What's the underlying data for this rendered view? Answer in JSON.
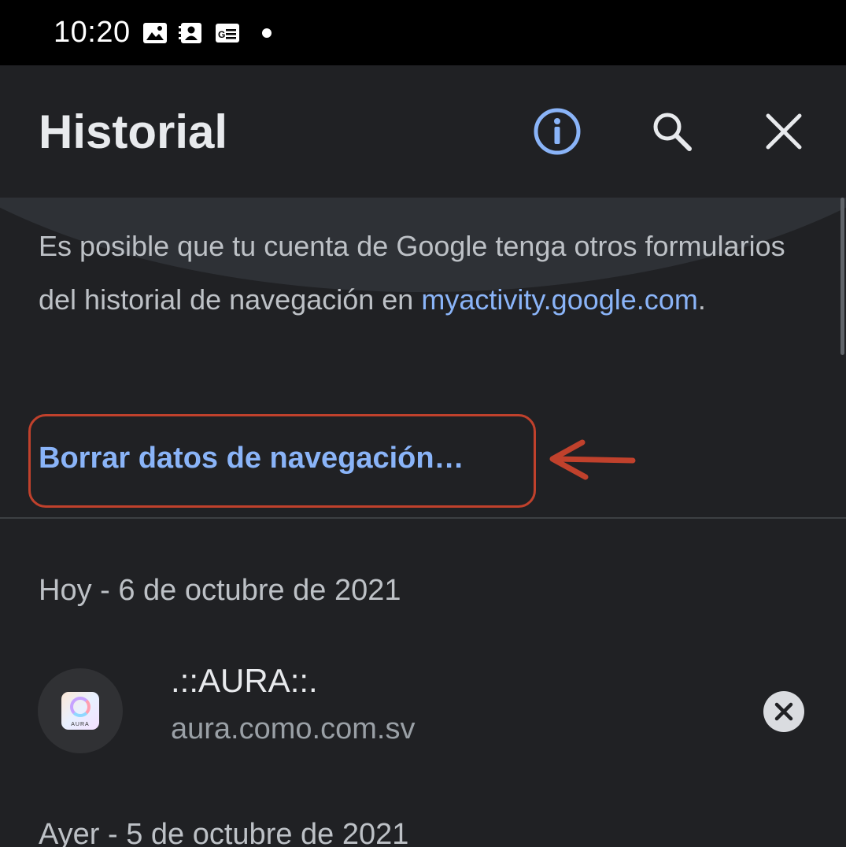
{
  "status_bar": {
    "time": "10:20",
    "icons": [
      "image-icon",
      "contacts-icon",
      "news-icon",
      "notification-dot"
    ]
  },
  "app_bar": {
    "title": "Historial",
    "actions": [
      "info-icon",
      "search-icon",
      "close-icon"
    ]
  },
  "info": {
    "text": "Es posible que tu cuenta de Google tenga otros formularios del historial de navegación en ",
    "link": "myactivity.google.com",
    "suffix": "."
  },
  "clear_browsing": {
    "label": "Borrar datos de navegación…"
  },
  "sections": [
    {
      "date": "Hoy - 6 de octubre de 2021",
      "items": [
        {
          "title": ".::AURA::.",
          "url": "aura.como.com.sv",
          "favicon_label": "AURA"
        }
      ]
    },
    {
      "date": "Ayer - 5 de octubre de 2021",
      "items": []
    }
  ],
  "colors": {
    "background": "#202124",
    "link": "#8ab4f8",
    "annotation": "#c0412c"
  }
}
